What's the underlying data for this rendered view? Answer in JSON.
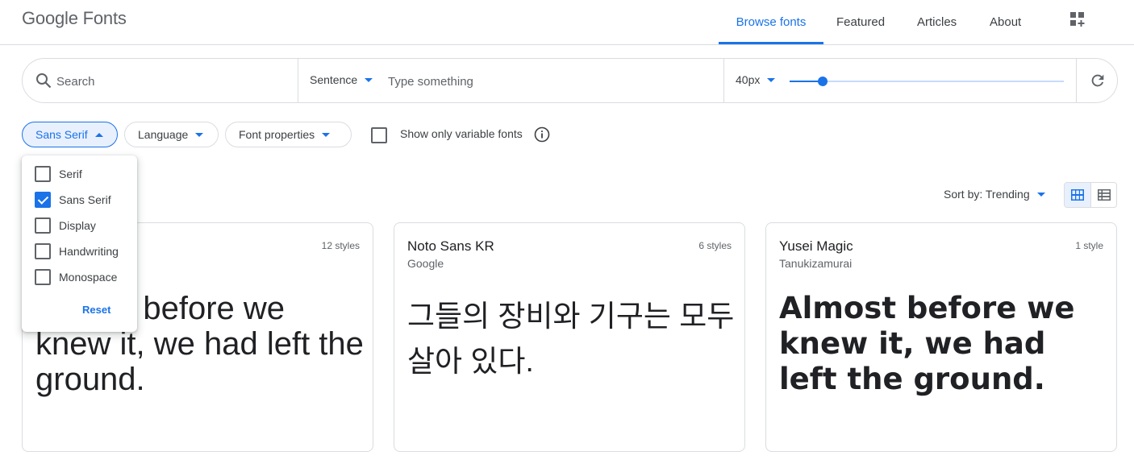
{
  "header": {
    "logo": "Google Fonts",
    "nav": {
      "browse": "Browse fonts",
      "featured": "Featured",
      "articles": "Articles",
      "about": "About"
    }
  },
  "toolbar": {
    "search_placeholder": "Search",
    "preview_mode": "Sentence",
    "preview_placeholder": "Type something",
    "font_size": "40px",
    "font_size_slider_fraction": 0.12
  },
  "filters": {
    "category": "Sans Serif",
    "language": "Language",
    "font_properties": "Font properties",
    "variable_label": "Show only variable fonts",
    "variable_checked": false
  },
  "category_menu": {
    "items": [
      {
        "label": "Serif",
        "checked": false
      },
      {
        "label": "Sans Serif",
        "checked": true
      },
      {
        "label": "Display",
        "checked": false
      },
      {
        "label": "Handwriting",
        "checked": false
      },
      {
        "label": "Monospace",
        "checked": false
      }
    ],
    "reset": "Reset"
  },
  "results": {
    "sort_label": "Sort by: Trending"
  },
  "cards": [
    {
      "name": "",
      "author": "",
      "styles": "12 styles",
      "preview": "Almost before we knew it, we had left the ground."
    },
    {
      "name": "Noto Sans KR",
      "author": "Google",
      "styles": "6 styles",
      "preview": "그들의 장비와 기구는 모두 살아 있다."
    },
    {
      "name": "Yusei Magic",
      "author": "Tanukizamurai",
      "styles": "1 style",
      "preview": "Almost before we knew it, we had left the ground."
    }
  ],
  "colors": {
    "accent": "#1a73e8",
    "border": "#dadce0",
    "chip_active_bg": "#e8f0fe"
  },
  "icons": [
    "search-icon",
    "refresh-icon",
    "info-icon",
    "grid-view-icon",
    "list-view-icon",
    "font-collection-icon"
  ]
}
